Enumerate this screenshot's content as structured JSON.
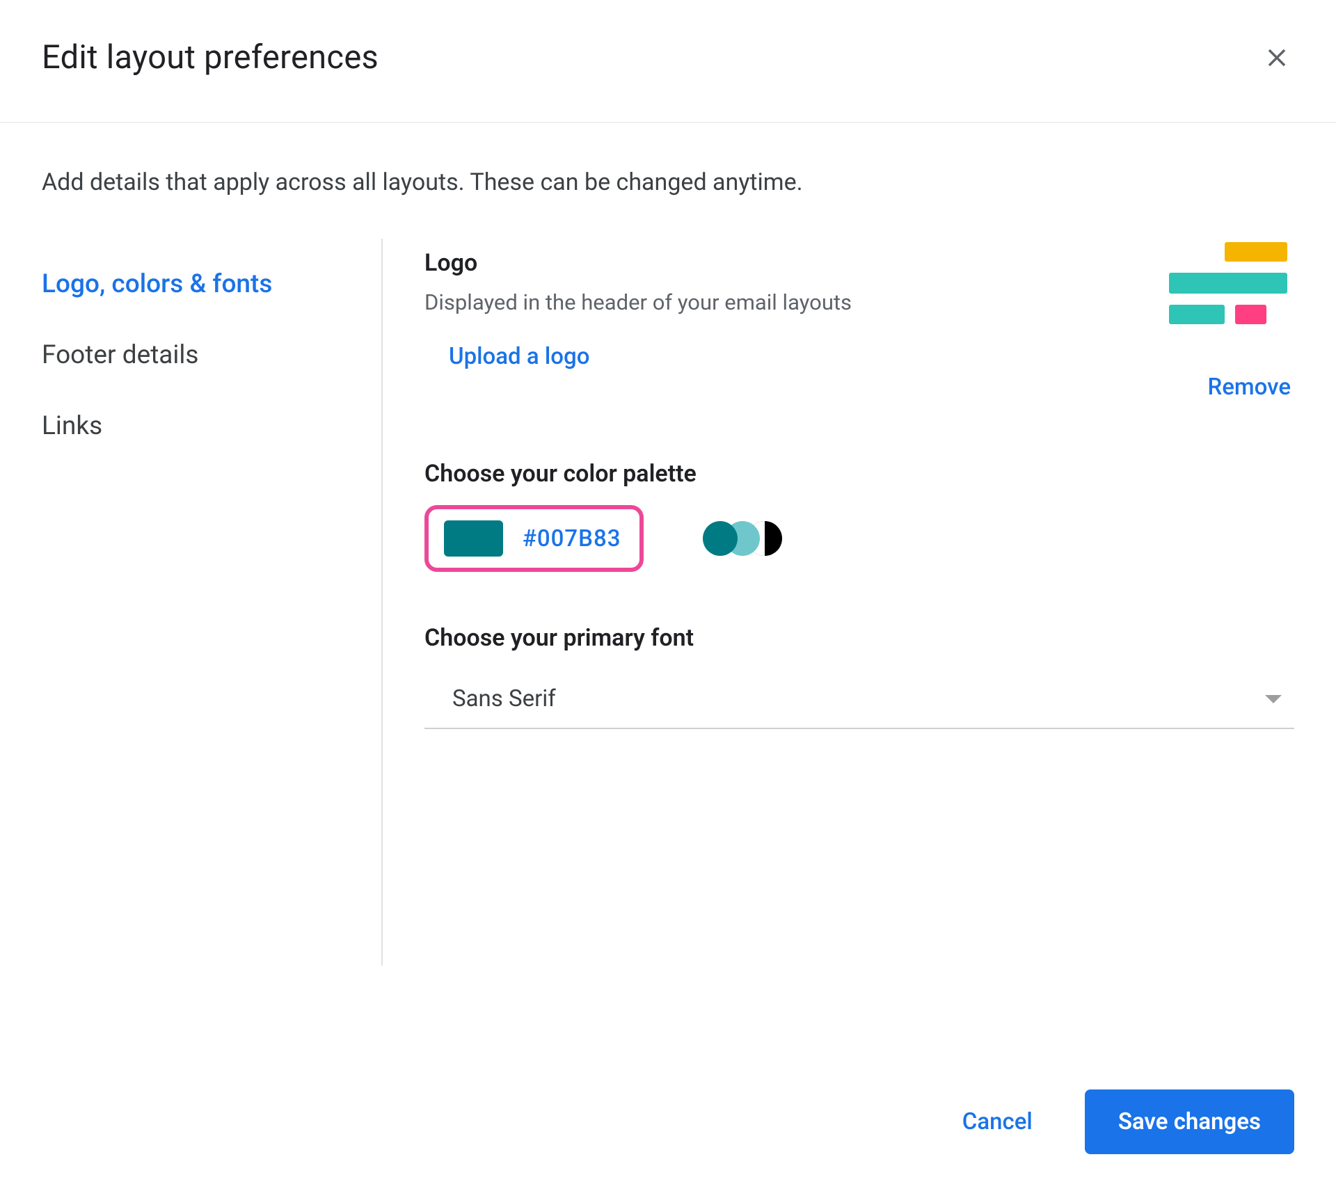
{
  "header": {
    "title": "Edit layout preferences"
  },
  "intro": "Add details that apply across all layouts. These can be changed anytime.",
  "sidebar": {
    "items": [
      {
        "label": "Logo, colors & fonts",
        "active": true
      },
      {
        "label": "Footer details",
        "active": false
      },
      {
        "label": "Links",
        "active": false
      }
    ]
  },
  "logo_section": {
    "heading": "Logo",
    "sub": "Displayed in the header of your email layouts",
    "upload_label": "Upload a logo",
    "remove_label": "Remove",
    "preview_colors": {
      "yellow": "#f5b400",
      "teal": "#2ec4b6",
      "pink": "#ff3f81"
    }
  },
  "color_section": {
    "heading": "Choose your color palette",
    "hex": "#007B83",
    "preview": [
      "#007b83",
      "#6fc7cc",
      "#000000"
    ]
  },
  "font_section": {
    "heading": "Choose your primary font",
    "value": "Sans Serif"
  },
  "footer": {
    "cancel": "Cancel",
    "save": "Save changes"
  }
}
